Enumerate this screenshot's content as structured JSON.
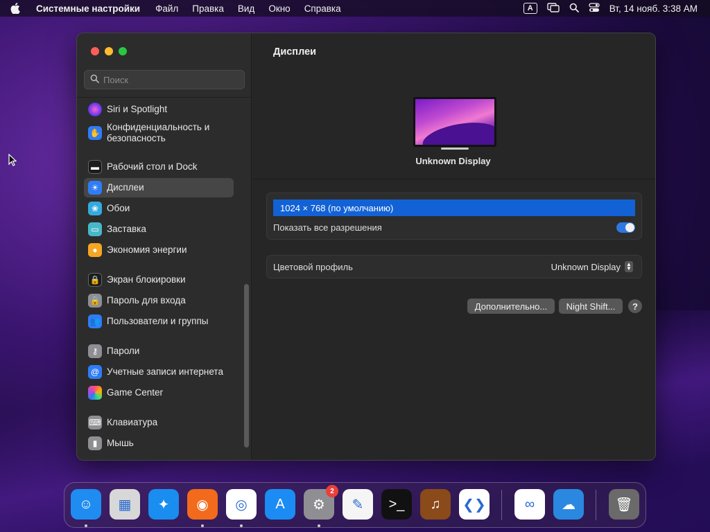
{
  "menubar": {
    "app_name": "Системные настройки",
    "items": [
      "Файл",
      "Правка",
      "Вид",
      "Окно",
      "Справка"
    ],
    "input_badge": "A",
    "datetime": "Вт, 14 нояб. 3:38 AM"
  },
  "window": {
    "search_placeholder": "Поиск",
    "sidebar": [
      {
        "label": "Siri и Spotlight",
        "icon": "siri-icon",
        "color": "#b44ad6"
      },
      {
        "label": "Конфиденциальность и безопасность",
        "icon": "hand-icon",
        "color": "#2f7cf6"
      },
      {
        "label": "Рабочий стол и Dock",
        "icon": "dock-icon",
        "color": "#1c1c1c"
      },
      {
        "label": "Дисплеи",
        "icon": "sun-icon",
        "color": "#2f7cf6",
        "selected": true
      },
      {
        "label": "Обои",
        "icon": "flower-icon",
        "color": "#34aadc"
      },
      {
        "label": "Заставка",
        "icon": "screensaver-icon",
        "color": "#48b8c8"
      },
      {
        "label": "Экономия энергии",
        "icon": "bulb-icon",
        "color": "#f5a623"
      },
      {
        "label": "Экран блокировки",
        "icon": "lock-screen-icon",
        "color": "#1c1c1c"
      },
      {
        "label": "Пароль для входа",
        "icon": "padlock-icon",
        "color": "#8e8e93"
      },
      {
        "label": "Пользователи и группы",
        "icon": "users-icon",
        "color": "#2f7cf6"
      },
      {
        "label": "Пароли",
        "icon": "key-icon",
        "color": "#8e8e93"
      },
      {
        "label": "Учетные записи интернета",
        "icon": "at-icon",
        "color": "#2f7cf6"
      },
      {
        "label": "Game Center",
        "icon": "game-center-icon",
        "color": "#f2f2f2"
      },
      {
        "label": "Клавиатура",
        "icon": "keyboard-icon",
        "color": "#8e8e93"
      },
      {
        "label": "Мышь",
        "icon": "mouse-icon",
        "color": "#8e8e93"
      }
    ],
    "content": {
      "title": "Дисплеи",
      "display_name": "Unknown Display",
      "resolution_selected": "1024 × 768 (по умолчанию)",
      "show_all_label": "Показать все разрешения",
      "show_all_on": true,
      "color_profile_label": "Цветовой профиль",
      "color_profile_value": "Unknown Display",
      "advanced_button": "Дополнительно...",
      "night_shift_button": "Night Shift...",
      "help_button": "?"
    }
  },
  "dock": {
    "items": [
      {
        "name": "finder",
        "color": "#1e8cf0",
        "glyph": "☺",
        "running": true
      },
      {
        "name": "launchpad",
        "color": "#d8d8d8",
        "glyph": "▦",
        "running": false
      },
      {
        "name": "safari",
        "color": "#1a8df0",
        "glyph": "✦",
        "running": false
      },
      {
        "name": "firefox",
        "color": "#f26a1b",
        "glyph": "◉",
        "running": true
      },
      {
        "name": "chrome",
        "color": "#ffffff",
        "glyph": "◎",
        "running": true
      },
      {
        "name": "app-store",
        "color": "#1b8cf4",
        "glyph": "A",
        "running": false
      },
      {
        "name": "system-settings",
        "color": "#8e8e93",
        "glyph": "⚙",
        "running": true,
        "badge": "2"
      },
      {
        "name": "textedit",
        "color": "#f5f5f5",
        "glyph": "✎",
        "running": false
      },
      {
        "name": "terminal",
        "color": "#111111",
        "glyph": ">_",
        "running": false
      },
      {
        "name": "instruments",
        "color": "#8a4a1a",
        "glyph": "♫",
        "running": false
      },
      {
        "name": "vscode",
        "color": "#ffffff",
        "glyph": "❮❯",
        "running": false
      },
      {
        "name": "visual-studio",
        "color": "#ffffff",
        "glyph": "∞",
        "running": false
      },
      {
        "name": "weather",
        "color": "#2a88e0",
        "glyph": "☁",
        "running": false
      },
      {
        "name": "trash",
        "color": "#6a6a6a",
        "glyph": "🗑",
        "running": false
      }
    ]
  }
}
